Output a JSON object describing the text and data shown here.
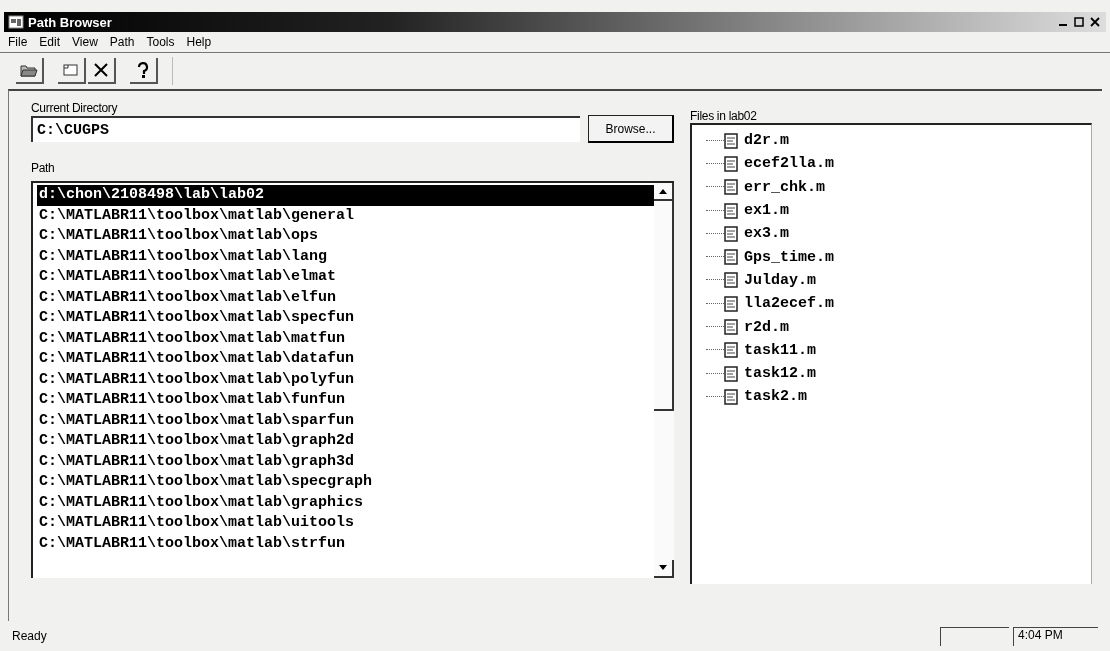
{
  "window": {
    "title": "Path Browser"
  },
  "menu": [
    "File",
    "Edit",
    "View",
    "Path",
    "Tools",
    "Help"
  ],
  "current_directory": {
    "label": "Current Directory",
    "value": "C:\\CUGPS",
    "button": "Browse..."
  },
  "path": {
    "label": "Path",
    "items": [
      {
        "text": "d:\\chon\\2108498\\lab\\lab02",
        "selected": true
      },
      {
        "text": "C:\\MATLABR11\\toolbox\\matlab\\general",
        "selected": false
      },
      {
        "text": "C:\\MATLABR11\\toolbox\\matlab\\ops",
        "selected": false
      },
      {
        "text": "C:\\MATLABR11\\toolbox\\matlab\\lang",
        "selected": false
      },
      {
        "text": "C:\\MATLABR11\\toolbox\\matlab\\elmat",
        "selected": false
      },
      {
        "text": "C:\\MATLABR11\\toolbox\\matlab\\elfun",
        "selected": false
      },
      {
        "text": "C:\\MATLABR11\\toolbox\\matlab\\specfun",
        "selected": false
      },
      {
        "text": "C:\\MATLABR11\\toolbox\\matlab\\matfun",
        "selected": false
      },
      {
        "text": "C:\\MATLABR11\\toolbox\\matlab\\datafun",
        "selected": false
      },
      {
        "text": "C:\\MATLABR11\\toolbox\\matlab\\polyfun",
        "selected": false
      },
      {
        "text": "C:\\MATLABR11\\toolbox\\matlab\\funfun",
        "selected": false
      },
      {
        "text": "C:\\MATLABR11\\toolbox\\matlab\\sparfun",
        "selected": false
      },
      {
        "text": "C:\\MATLABR11\\toolbox\\matlab\\graph2d",
        "selected": false
      },
      {
        "text": "C:\\MATLABR11\\toolbox\\matlab\\graph3d",
        "selected": false
      },
      {
        "text": "C:\\MATLABR11\\toolbox\\matlab\\specgraph",
        "selected": false
      },
      {
        "text": "C:\\MATLABR11\\toolbox\\matlab\\graphics",
        "selected": false
      },
      {
        "text": "C:\\MATLABR11\\toolbox\\matlab\\uitools",
        "selected": false
      },
      {
        "text": "C:\\MATLABR11\\toolbox\\matlab\\strfun",
        "selected": false
      }
    ]
  },
  "files": {
    "label": "Files in lab02",
    "items": [
      "d2r.m",
      "ecef2lla.m",
      "err_chk.m",
      "ex1.m",
      "ex3.m",
      "Gps_time.m",
      "Julday.m",
      "lla2ecef.m",
      "r2d.m",
      "task11.m",
      "task12.m",
      "task2.m"
    ]
  },
  "status_bar": {
    "text": "Ready",
    "time": "4:04 PM"
  }
}
